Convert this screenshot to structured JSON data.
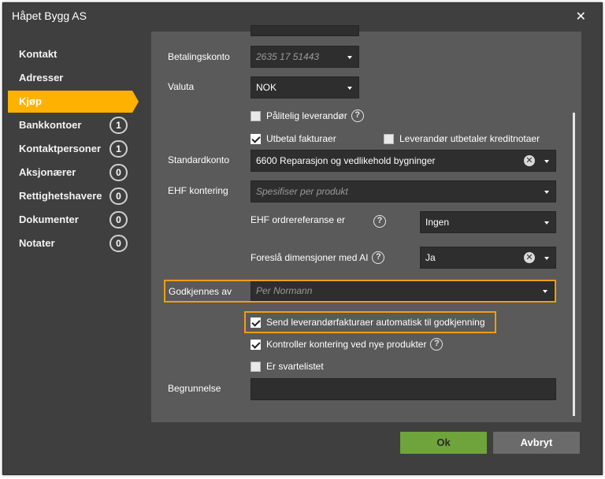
{
  "dialog": {
    "title": "Håpet Bygg AS"
  },
  "nav": [
    {
      "label": "Kontakt",
      "badge": null,
      "active": false
    },
    {
      "label": "Adresser",
      "badge": null,
      "active": false
    },
    {
      "label": "Kjøp",
      "badge": null,
      "active": true
    },
    {
      "label": "Bankkontoer",
      "badge": "1",
      "active": false
    },
    {
      "label": "Kontaktpersoner",
      "badge": "1",
      "active": false
    },
    {
      "label": "Aksjonærer",
      "badge": "0",
      "active": false
    },
    {
      "label": "Rettighetshavere",
      "badge": "0",
      "active": false
    },
    {
      "label": "Dokumenter",
      "badge": "0",
      "active": false
    },
    {
      "label": "Notater",
      "badge": "0",
      "active": false
    }
  ],
  "form": {
    "betalingskonto": {
      "label": "Betalingskonto",
      "value": "2635 17 51443"
    },
    "valuta": {
      "label": "Valuta",
      "value": "NOK"
    },
    "palitelig": {
      "label": "Pålitelig leverandør",
      "checked": false
    },
    "utbetal": {
      "label": "Utbetal fakturaer",
      "checked": true
    },
    "kreditnotaer": {
      "label": "Leverandør utbetaler kreditnotaer",
      "checked": false
    },
    "standardkonto": {
      "label": "Standardkonto",
      "value": "6600 Reparasjon og vedlikehold bygninger"
    },
    "ehf_kontering": {
      "label": "EHF kontering",
      "placeholder": "Spesifiser per produkt"
    },
    "ehf_ordre": {
      "label": "EHF ordrereferanse er",
      "value": "Ingen"
    },
    "foresla": {
      "label": "Foreslå dimensjoner med AI",
      "value": "Ja"
    },
    "godkjennes": {
      "label": "Godkjennes av",
      "placeholder": "Per Normann"
    },
    "send_auto": {
      "label": "Send leverandørfakturaer automatisk til godkjenning",
      "checked": true
    },
    "kontroller": {
      "label": "Kontroller kontering ved nye produkter",
      "checked": true
    },
    "svarteliste": {
      "label": "Er svartelistet",
      "checked": false
    },
    "begrunnelse": {
      "label": "Begrunnelse",
      "value": ""
    }
  },
  "buttons": {
    "ok": "Ok",
    "cancel": "Avbryt"
  },
  "colors": {
    "accent": "#ffb100",
    "highlight": "#f39c12",
    "ok": "#6fa33b",
    "panel": "#5a5a5a",
    "dialog": "#3f3f3f"
  }
}
